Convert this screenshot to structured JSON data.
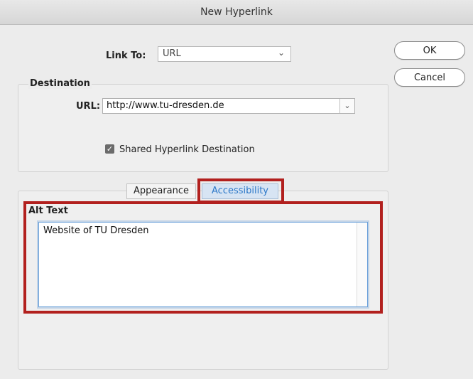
{
  "window": {
    "title": "New Hyperlink"
  },
  "actions": {
    "ok": "OK",
    "cancel": "Cancel"
  },
  "link_to": {
    "label": "Link To:",
    "value": "URL"
  },
  "destination": {
    "title": "Destination",
    "url_label": "URL:",
    "url_value": "http://www.tu-dresden.de",
    "shared_label": "Shared Hyperlink Destination",
    "shared_checked": true
  },
  "tabs": [
    {
      "label": "Appearance",
      "active": false
    },
    {
      "label": "Accessibility",
      "active": true
    }
  ],
  "alt_text": {
    "title": "Alt Text",
    "value": "Website of TU Dresden"
  },
  "highlight_color": "#b2201e",
  "accent_color": "#2c78c8",
  "icons": {
    "select_chevron": "chevron-down-icon",
    "checkbox": "checkmark-icon"
  }
}
